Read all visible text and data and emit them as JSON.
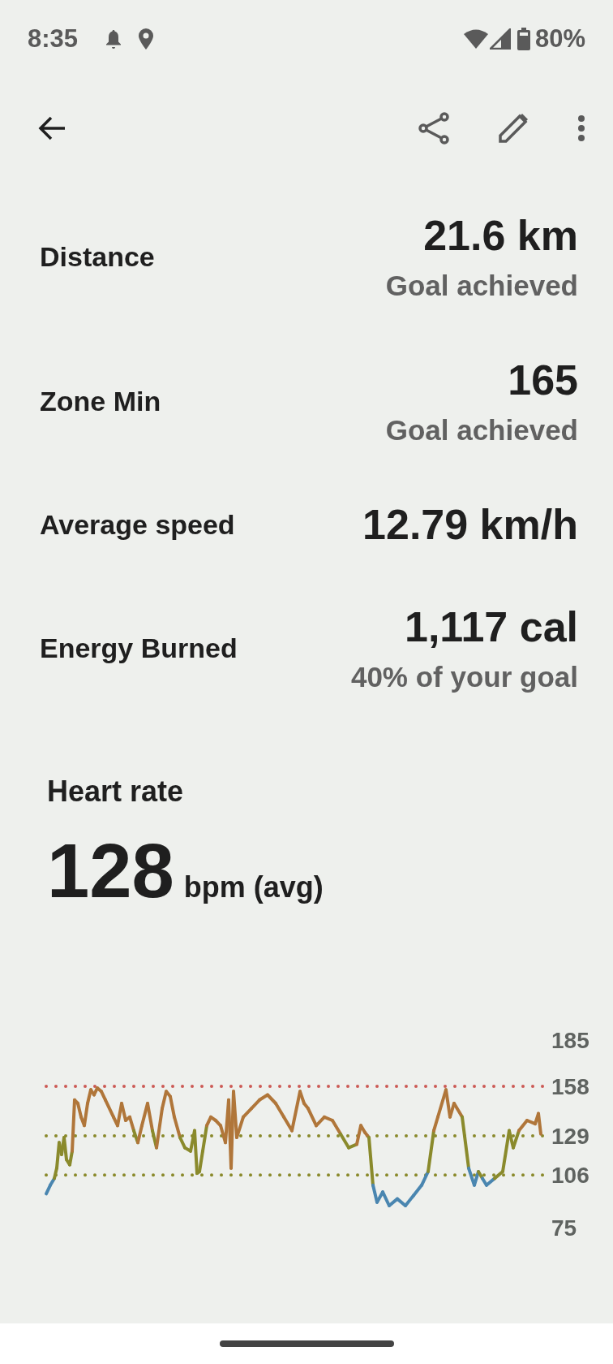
{
  "status_bar": {
    "time": "8:35",
    "battery": "80%"
  },
  "stats": [
    {
      "label": "Distance",
      "value": "21.6 km",
      "note": "Goal achieved"
    },
    {
      "label": "Zone Min",
      "value": "165",
      "note": "Goal achieved"
    },
    {
      "label": "Average speed",
      "value": "12.79 km/h"
    },
    {
      "label": "Energy Burned",
      "value": "1,117 cal",
      "note": "40% of your goal"
    }
  ],
  "heart_rate": {
    "title": "Heart rate",
    "value": "128",
    "unit": "bpm (avg)",
    "chart": {
      "ticks": [
        {
          "label": "185"
        },
        {
          "label": "158",
          "color": "#cc5a55"
        },
        {
          "label": "129",
          "color": "#8a8a2c"
        },
        {
          "label": "106",
          "color": "#8a8a2c"
        },
        {
          "label": "75"
        }
      ]
    }
  }
}
